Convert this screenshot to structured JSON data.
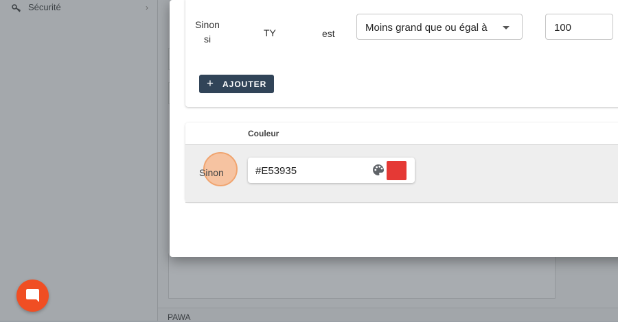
{
  "sidebar": {
    "items": [
      {
        "label": "Sécurité",
        "icon": "key-icon"
      }
    ]
  },
  "condition": {
    "prefix": [
      "Sinon",
      "si"
    ],
    "field": "TY",
    "verb": "est",
    "operator": "Moins grand que ou égal à",
    "value": "100"
  },
  "actions": {
    "add_label": "AJOUTER",
    "add_icon": "plus-icon"
  },
  "table": {
    "header": "Couleur",
    "rows": [
      {
        "label": "Sinon",
        "color_value": "#E53935",
        "swatch": "#E53935"
      }
    ]
  },
  "footer": {
    "text": "PAWA"
  },
  "colors": {
    "primary_button": "#314458",
    "chat_launcher": "#F04E23",
    "ripple": "#F6C3A1"
  }
}
